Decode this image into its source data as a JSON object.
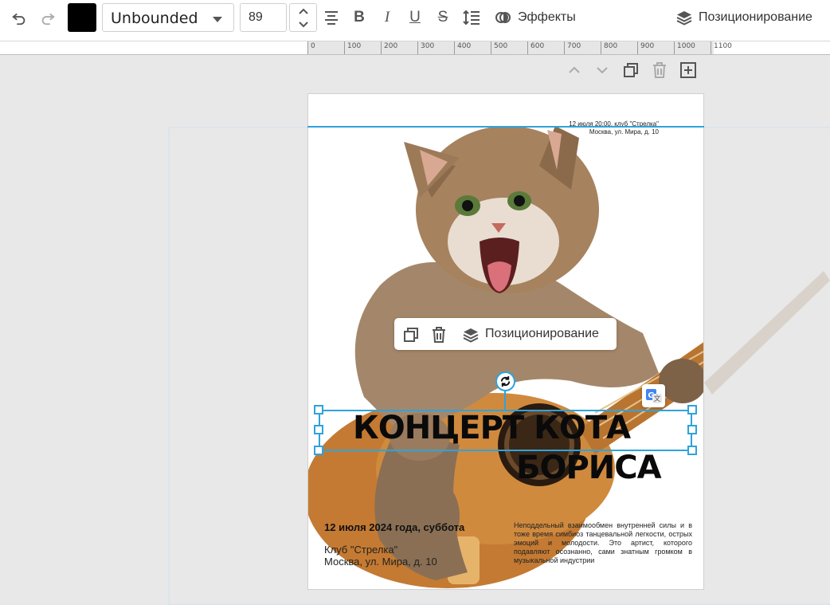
{
  "toolbar": {
    "font_color": "#000000",
    "font_family": "Unbounded",
    "font_size": "89",
    "effects_label": "Эффекты",
    "positioning_label": "Позиционирование"
  },
  "ruler": {
    "labels": [
      "0",
      "100",
      "200",
      "300",
      "400",
      "500",
      "600",
      "700",
      "800",
      "900",
      "1000",
      "1100"
    ]
  },
  "poster": {
    "venue_small_line1": "12 июля 20:00, клуб \"Стрелка\"",
    "venue_small_line2": "Москва, ул. Мира, д. 10",
    "headline_line1": "КОНЦЕРТ КОТА",
    "headline_line2": "БОРИСА",
    "date_line": "12 июля 2024 года, суббота",
    "club_line1": "Клуб \"Стрелка\"",
    "club_line2": "Москва, ул. Мира, д. 10",
    "description": "Неподдельный взаимообмен внутренней силы и в тоже время симбиоз танцевальной легкости, острых эмоций и молодости. Это артист, которого подавляют осознанно, сами знатным громком в музыкальной индустрии"
  },
  "context_menu": {
    "positioning_label": "Позиционирование"
  },
  "colors": {
    "accent": "#2ea3dc",
    "page_bg": "#ffffff",
    "workspace_bg": "#e8e8e8"
  }
}
